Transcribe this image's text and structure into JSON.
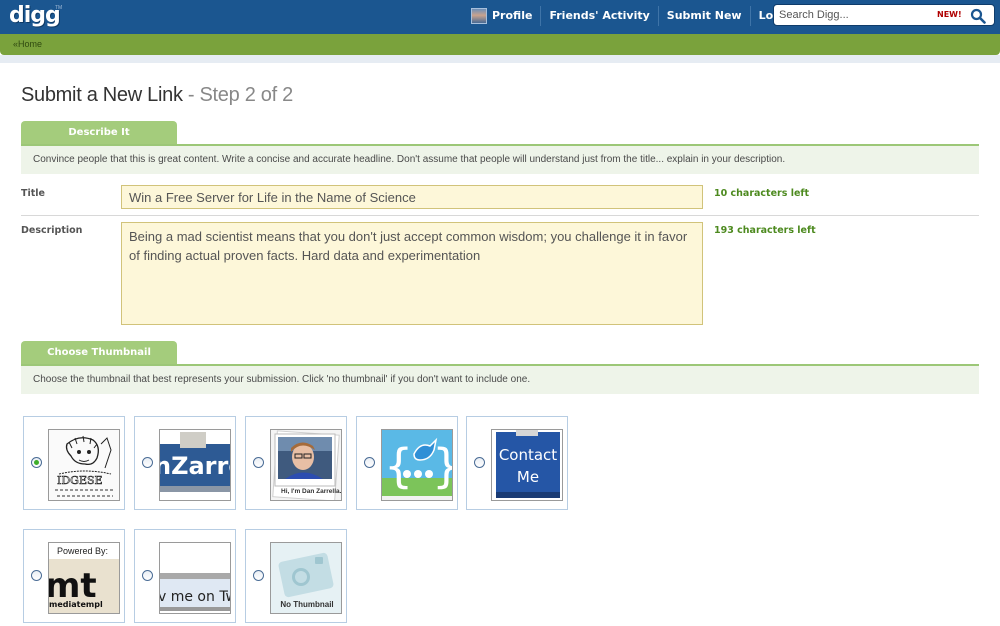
{
  "header": {
    "logo": "digg",
    "logo_tm": "TM",
    "nav": [
      {
        "label": "Profile",
        "icon": "user-avatar-icon"
      },
      {
        "label": "Friends' Activity"
      },
      {
        "label": "Submit New"
      },
      {
        "label": "Logout"
      }
    ],
    "search": {
      "placeholder": "Search Digg...",
      "badge": "NEW!",
      "icon": "search-icon"
    }
  },
  "breadcrumb": {
    "home_label": "«Home"
  },
  "page": {
    "title": "Submit a New Link",
    "step": " - Step 2 of 2"
  },
  "describe": {
    "tab_label": "Describe It",
    "hint": "Convince people that this is great content. Write a concise and accurate headline. Don't assume that people will understand just from the title... explain in your description.",
    "title_label": "Title",
    "title_value": "Win a Free Server for Life in the Name of Science",
    "title_chars_left": "10 characters left",
    "description_label": "Description",
    "description_value": "Being a mad scientist means that you don't just accept common wisdom; you challenge it in favor of finding actual proven facts. Hard data and experimentation",
    "description_chars_left": "193 characters left"
  },
  "thumbnail": {
    "tab_label": "Choose Thumbnail",
    "hint": "Choose the thumbnail that best represents your submission. Click 'no thumbnail' if you don't want to include one.",
    "options": [
      {
        "id": "sketch",
        "selected": true,
        "caption": ""
      },
      {
        "id": "zarrella-banner",
        "selected": false,
        "caption": "nZarre"
      },
      {
        "id": "portrait",
        "selected": false,
        "caption": "Hi, I'm Dan Zarrella."
      },
      {
        "id": "bird-logo",
        "selected": false,
        "caption": ""
      },
      {
        "id": "contact-me",
        "selected": false,
        "caption": "Contact Me"
      },
      {
        "id": "mediatemple",
        "selected": false,
        "caption_top": "Powered By:",
        "caption": "mt",
        "caption_small": "mediatempl"
      },
      {
        "id": "follow-twitter",
        "selected": false,
        "caption": "v me on Tw"
      },
      {
        "id": "no-thumbnail",
        "selected": false,
        "caption": "No Thumbnail"
      }
    ]
  }
}
